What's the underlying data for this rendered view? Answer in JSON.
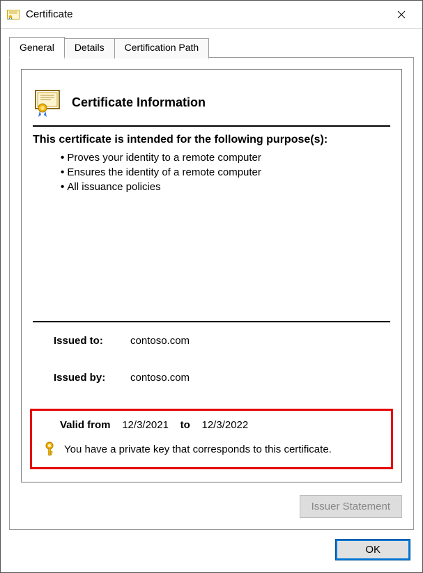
{
  "window": {
    "title": "Certificate"
  },
  "tabs": {
    "general": "General",
    "details": "Details",
    "certpath": "Certification Path"
  },
  "cert": {
    "info_title": "Certificate Information",
    "purposes_title": "This certificate is intended for the following purpose(s):",
    "purposes": [
      "Proves your identity to a remote computer",
      "Ensures the identity of a remote computer",
      "All issuance policies"
    ],
    "issued_to_label": "Issued to:",
    "issued_to_value": "contoso.com",
    "issued_by_label": "Issued by:",
    "issued_by_value": "contoso.com",
    "valid_from_label": "Valid from",
    "valid_from_value": "12/3/2021",
    "valid_to_label": "to",
    "valid_to_value": "12/3/2022",
    "private_key_msg": "You have a private key that corresponds to this certificate."
  },
  "buttons": {
    "issuer_statement": "Issuer Statement",
    "ok": "OK"
  }
}
